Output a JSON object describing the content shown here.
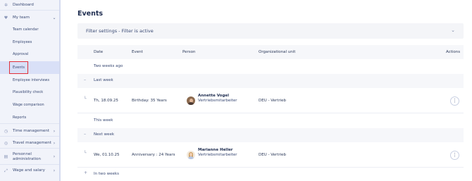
{
  "sidebar": {
    "items": [
      {
        "label": "Dashboard",
        "icon": "dashboard-icon"
      },
      {
        "label": "My team",
        "icon": "team-icon",
        "expanded": true
      },
      {
        "label": "Team calendar"
      },
      {
        "label": "Employees"
      },
      {
        "label": "Approval"
      },
      {
        "label": "Events",
        "active": true
      },
      {
        "label": "Employee interviews"
      },
      {
        "label": "Plausibility check"
      },
      {
        "label": "Wage comparison"
      },
      {
        "label": "Reports"
      },
      {
        "label": "Time management",
        "icon": "clock-icon"
      },
      {
        "label": "Travel management",
        "icon": "travel-icon"
      },
      {
        "label": "Personnel administration",
        "label_line1": "Personnel",
        "label_line2": "administration",
        "icon": "personnel-icon"
      },
      {
        "label": "Wage and salary",
        "icon": "wage-icon"
      }
    ]
  },
  "page": {
    "title": "Events",
    "filter_label": "Filter settings - Filter is active"
  },
  "table": {
    "headers": {
      "date": "Date",
      "event": "Event",
      "person": "Person",
      "org_unit": "Organizational unit",
      "actions": "Actions"
    },
    "groups": [
      {
        "label": "Two weeks ago"
      },
      {
        "label": "Last week"
      },
      {
        "label": "This week"
      },
      {
        "label": "Next week"
      },
      {
        "label": "In two weeks"
      }
    ],
    "rows": [
      {
        "date": "Th, 18.09.25",
        "event": "Birthday: 35 Years",
        "name": "Annette Vogel",
        "role": "Vertriebsmitarbeiter",
        "org_unit": "DEU - Vertrieb"
      },
      {
        "date": "We, 01.10.25",
        "event": "Anniversary : 24 Years",
        "name": "Marianne Heller",
        "role": "Vertriebsmitarbeiter",
        "org_unit": "DEU - Vertrieb"
      }
    ]
  },
  "colors": {
    "highlight": "#e0303a",
    "sidebar_bg": "#f1f3fa",
    "active_bg": "#d9e0f7"
  }
}
